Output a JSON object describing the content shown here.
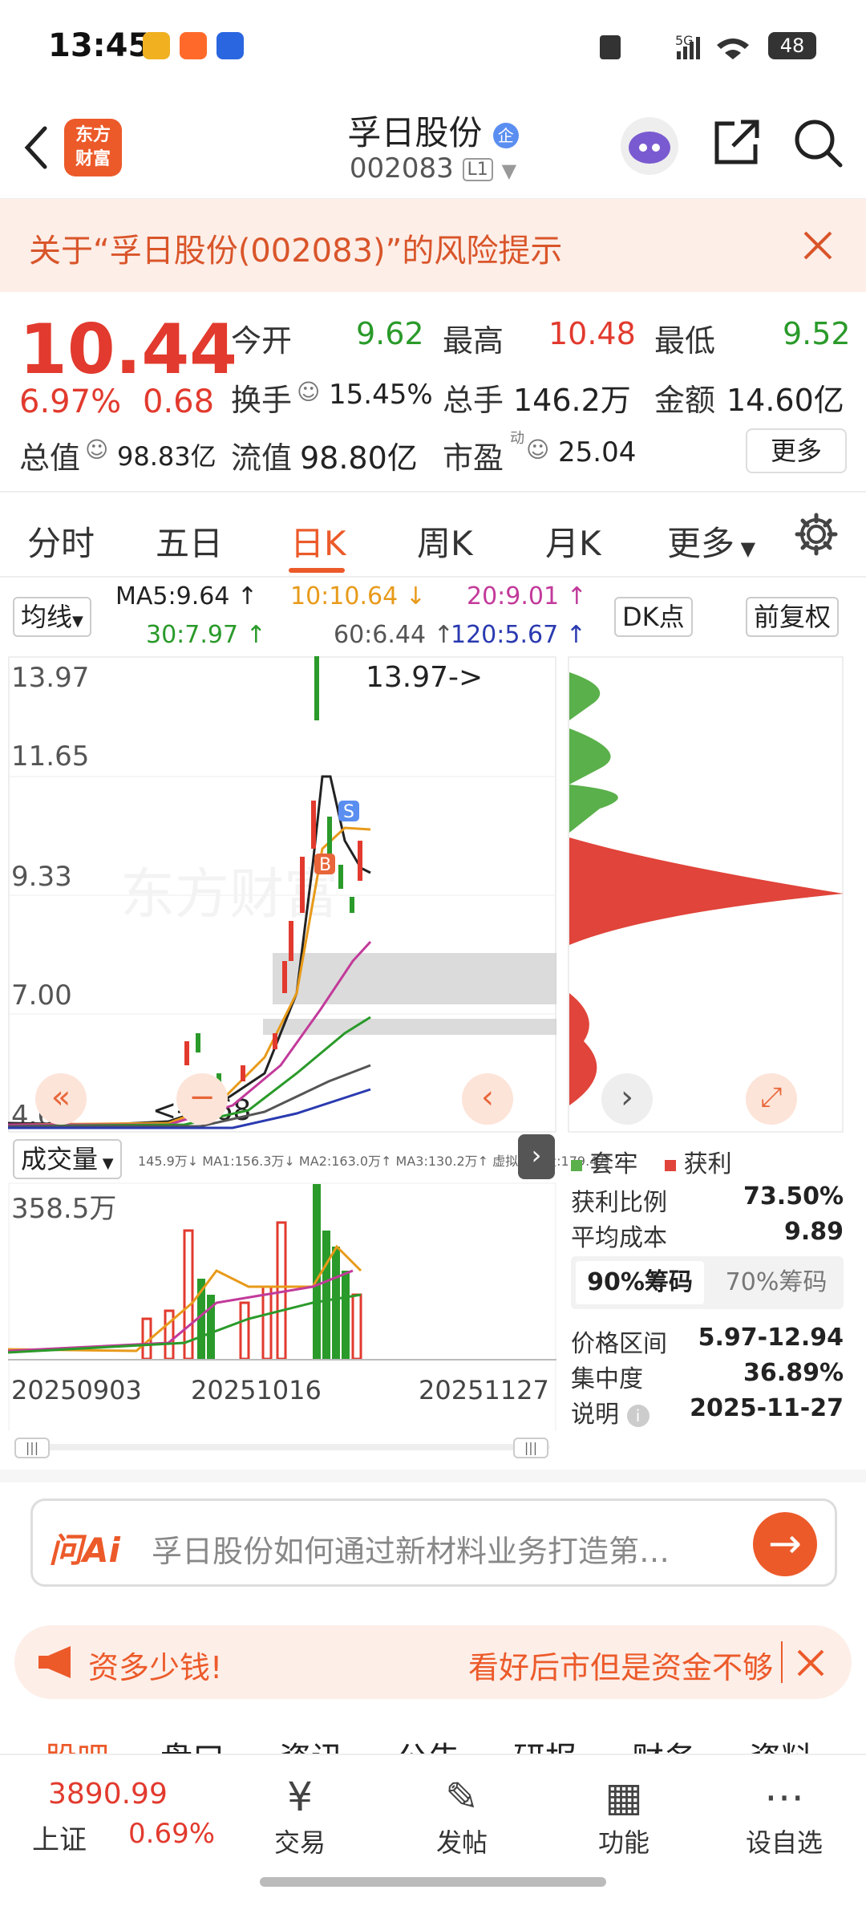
{
  "status_bar": {
    "time": "13:45",
    "network": "5G",
    "battery": "48"
  },
  "header": {
    "back_icon": "chevron-left-icon",
    "logo_line1": "东方",
    "logo_line2": "财富",
    "stock_name": "孚日股份",
    "badge": "企",
    "stock_code": "002083",
    "level": "L1",
    "share_icon": "share-icon",
    "search_icon": "search-icon"
  },
  "risk_banner": {
    "text": "关于“孚日股份(002083)”的风险提示",
    "close_icon": "close-icon"
  },
  "quote": {
    "price": "10.44",
    "change_pct": "6.97%",
    "change": "0.68",
    "open_label": "今开",
    "open": "9.62",
    "high_label": "最高",
    "high": "10.48",
    "low_label": "最低",
    "low": "9.52",
    "turnover_label": "换手",
    "turnover": "15.45%",
    "volume_label": "总手",
    "volume": "146.2万",
    "amount_label": "金额",
    "amount": "14.60亿",
    "mcap_label": "总值",
    "mcap": "98.83亿",
    "float_label": "流值",
    "float": "98.80亿",
    "pe_label": "市盈",
    "pe_sup": "动",
    "pe": "25.04",
    "more_button": "更多"
  },
  "tabs": [
    "分时",
    "五日",
    "日K",
    "周K",
    "月K",
    "更多"
  ],
  "active_tab": "日K",
  "ma": {
    "selector": "均线",
    "ma5": "MA5:9.64 ↑",
    "ma10": "10:10.64 ↓",
    "ma20": "20:9.01 ↑",
    "ma30": "30:7.97 ↑",
    "ma60": "60:6.44 ↑",
    "ma120": "120:5.67 ↑",
    "dk_button": "DK点",
    "adjust_button": "前复权",
    "colors": {
      "ma5": "#222222",
      "ma10": "#e89a1a",
      "ma20": "#c23a9a",
      "ma30": "#2a9a2a",
      "ma60": "#555555",
      "ma120": "#2a3ab0"
    }
  },
  "kline": {
    "y_labels": [
      "13.97",
      "11.65",
      "9.33",
      "7.00",
      "4.68"
    ],
    "high_marker": "13.97->",
    "low_marker": "<-4.68",
    "watermark": "东方财富",
    "buy_label": "B",
    "sell_label": "S"
  },
  "volume_panel": {
    "selector": "成交量",
    "stats": "145.9万↓  MA1:156.3万↓  MA2:163.0万↑  MA3:130.2万↑  虚拟成交量:179.4万",
    "max_label": "358.5万",
    "dates": [
      "20250903",
      "20251016",
      "20251127"
    ]
  },
  "chips": {
    "legend_trapped": "套牢",
    "legend_profit": "获利",
    "profit_ratio_label": "获利比例",
    "profit_ratio": "73.50%",
    "avg_cost_label": "平均成本",
    "avg_cost": "9.89",
    "tab_90": "90%筹码",
    "tab_70": "70%筹码",
    "range_label": "价格区间",
    "range": "5.97-12.94",
    "concentration_label": "集中度",
    "concentration": "36.89%",
    "note_label": "说明",
    "note_date": "2025-11-27"
  },
  "ai_bar": {
    "brand": "问Ai",
    "placeholder": "孚日股份如何通过新材料业务打造第…",
    "go_icon": "arrow-right-icon"
  },
  "ad_banner": {
    "left_text": "资多少钱!",
    "right_text": "看好后市但是资金不够",
    "close_icon": "close-icon"
  },
  "sub_tabs": [
    "股吧",
    "盘口",
    "资讯",
    "公告",
    "研报",
    "财务",
    "资料"
  ],
  "bottom_nav": {
    "index_value": "3890.99",
    "index_name": "上证",
    "index_change": "0.69%",
    "items": [
      {
        "label": "交易",
        "icon": "yuan-exchange-icon"
      },
      {
        "label": "发帖",
        "icon": "edit-icon"
      },
      {
        "label": "功能",
        "icon": "grid-icon"
      },
      {
        "label": "设自选",
        "icon": "more-dots-icon"
      }
    ]
  }
}
